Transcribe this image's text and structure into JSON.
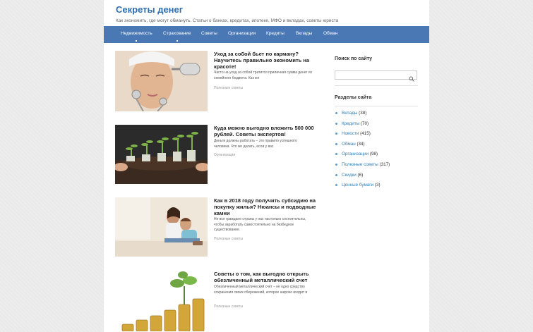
{
  "site": {
    "title": "Секреты денег",
    "description": "Как экономить, где могут обмануть. Статьи о банках, кредитах, ипотеке, МФО и вкладах, советы юриста"
  },
  "nav": {
    "items": [
      {
        "label": "Недвижимость",
        "has_submenu": true
      },
      {
        "label": "Страхование",
        "has_submenu": true
      },
      {
        "label": "Советы",
        "has_submenu": false
      },
      {
        "label": "Организации",
        "has_submenu": false
      },
      {
        "label": "Кредиты",
        "has_submenu": false
      },
      {
        "label": "Вклады",
        "has_submenu": false
      },
      {
        "label": "Обман",
        "has_submenu": false
      }
    ]
  },
  "posts": [
    {
      "title": "Уход за собой бьет по карману? Научитесь правильно экономить на красоте!",
      "excerpt": "Часто на уход за собой тратится приличная сумма денег из семейного бюджета. Как же",
      "category": "Полезные советы"
    },
    {
      "title": "Куда можно выгодно вложить 500 000 рублей. Советы экспертов!",
      "excerpt": "Деньги должны работать – это правило успешного человека. Что же делать, если у вас",
      "category": "Организации"
    },
    {
      "title": "Как в 2018 году получить субсидию на покупку жилья? Нюансы и подводные камни",
      "excerpt": "Не все граждане страны у нас настолько состоятельны, чтобы заработать самостоятельно на безбедное существование.",
      "category": "Полезные советы"
    },
    {
      "title": "Советы о том, как выгодно открыть обезличенный металлический счет",
      "excerpt": "Обезличенный металлический счет – не одно средство сохранения своих сбережений, которое широко входит в",
      "category": "Полезные советы"
    }
  ],
  "sidebar": {
    "search_title": "Поиск по сайту",
    "search_placeholder": "",
    "categories_title": "Разделы сайта",
    "categories": [
      {
        "name": "Вклады",
        "count": "(38)"
      },
      {
        "name": "Кредиты",
        "count": "(70)"
      },
      {
        "name": "Новости",
        "count": "(415)"
      },
      {
        "name": "Обман",
        "count": "(34)"
      },
      {
        "name": "Организации",
        "count": "(98)"
      },
      {
        "name": "Полезные советы",
        "count": "(317)"
      },
      {
        "name": "Скидки",
        "count": "(6)"
      },
      {
        "name": "Ценные бумаги",
        "count": "(3)"
      }
    ]
  },
  "colors": {
    "nav_bg": "#4a78b5",
    "title": "#2f6fae",
    "link": "#2f7fb8"
  }
}
